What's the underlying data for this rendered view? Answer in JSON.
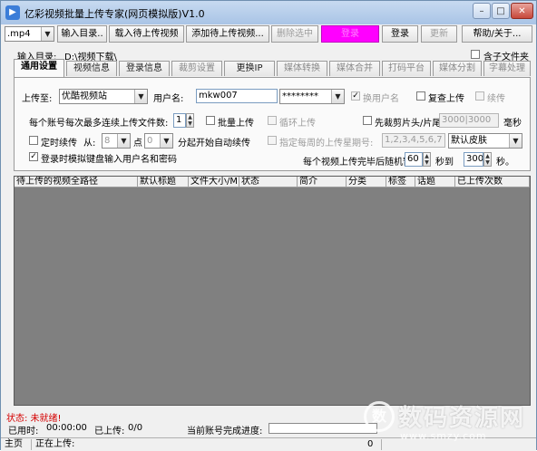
{
  "window": {
    "title": "亿彩视频批量上传专家(网页模拟版)V1.0",
    "minimize": "–",
    "maximize": "□",
    "close": "✕"
  },
  "toolbar": {
    "format_value": ".mp4",
    "input_dir": "输入目录..",
    "import_pending": "载入待上传视频",
    "add_pending": "添加待上传视频...",
    "delete_selected": "删除选中",
    "magenta_btn": "登录",
    "login": "登录",
    "update": "更新",
    "help": "帮助/关于..."
  },
  "input_dir": {
    "label": "输入目录:",
    "value": "D:\\视频下载\\",
    "include_subfolders": "含子文件夹"
  },
  "tabs": [
    {
      "label": "通用设置",
      "state": "active"
    },
    {
      "label": "视频信息",
      "state": "normal"
    },
    {
      "label": "登录信息",
      "state": "normal"
    },
    {
      "label": "裁剪设置",
      "state": "gray"
    },
    {
      "label": "更换IP",
      "state": "normal"
    },
    {
      "label": "媒体转换",
      "state": "gray"
    },
    {
      "label": "媒体合并",
      "state": "gray"
    },
    {
      "label": "打码平台",
      "state": "gray"
    },
    {
      "label": "媒体分割",
      "state": "gray"
    },
    {
      "label": "字幕处理",
      "state": "gray"
    }
  ],
  "general": {
    "upload_to_label": "上传至:",
    "upload_to_value": "优酷视频站",
    "username_label": "用户名:",
    "username_value": "mkw007",
    "password_value": "********",
    "switch_user": "换用户名",
    "recheck_upload": "复查上传",
    "resume": "续传",
    "max_files_label": "每个账号每次最多连续上传文件数:",
    "max_files_value": "1",
    "batch_upload": "批量上传",
    "loop_upload": "循环上传",
    "clip_head_tail": "先裁剪片头/片尾",
    "clip_value": "3000|3000",
    "clip_unit": "毫秒",
    "timed_resume": "定时续传",
    "from_label": "从:",
    "from_value": "8",
    "point_label": "点",
    "point_value": "0",
    "auto_resume": "分起开始自动续传",
    "weekly_label": "指定每周的上传星期号:",
    "weekly_value": "1,2,3,4,5,6,7",
    "skin_value": "默认皮肤",
    "keyboard_login": "登录时模拟键盘输入用户名和密码",
    "random_pause_label": "每个视频上传完毕后随机暂停:",
    "pause_from": "60",
    "to_label": "秒到",
    "pause_to": "300",
    "sec_label": "秒。"
  },
  "table": {
    "columns": [
      "待上传的视频全路径",
      "默认标题",
      "文件大小/M",
      "状态",
      "简介",
      "分类",
      "标签",
      "话题",
      "已上传次数"
    ],
    "rows": []
  },
  "status": {
    "state": "状态: 未就绪!",
    "elapsed_label": "已用时:",
    "elapsed_value": "00:00:00",
    "uploaded_label": "已上传:",
    "uploaded_value": "0/0",
    "progress_label": "当前账号完成进度:",
    "progress": 0
  },
  "statusbar": {
    "page": "主页",
    "uploading_label": "正在上传:",
    "tail_value": "0"
  },
  "watermark": {
    "logo": "数",
    "text": "数码资源网",
    "sub": "www.smzy.com"
  },
  "colors": {
    "magenta": "#ff00ff",
    "title_grad": "#a9c4e6",
    "grid_bg": "#808080",
    "status_red": "#d40000"
  }
}
